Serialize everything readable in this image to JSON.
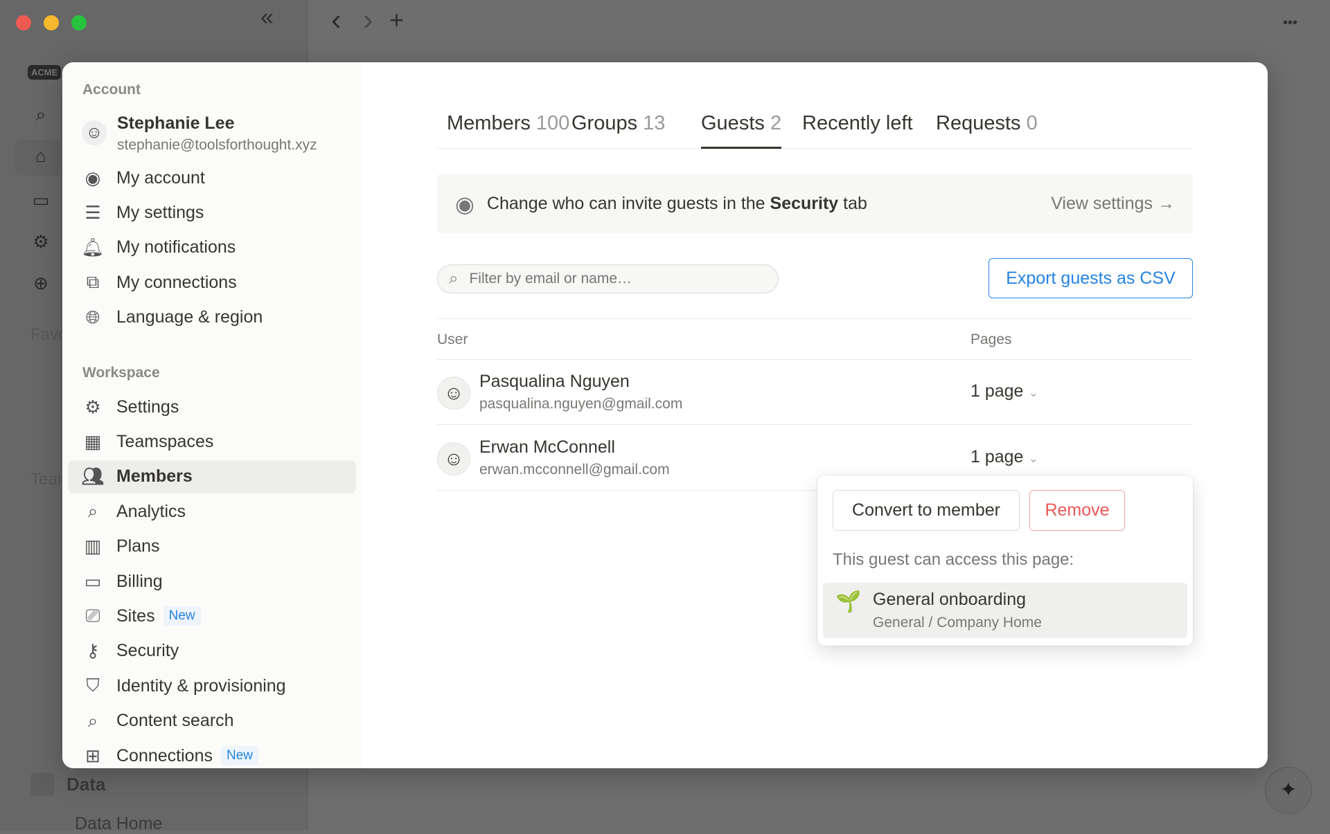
{
  "window": {
    "controls": [
      "close",
      "minimize",
      "zoom"
    ],
    "collapse_icon": "«",
    "back_icon": "‹",
    "forward_icon": "›",
    "add_icon": "+",
    "more_icon": "•••"
  },
  "background_app": {
    "logo": "ACME",
    "section_favorites": "Favo",
    "section_teamspaces": "Tean",
    "data_label": "Data",
    "data_home_label": "Data Home"
  },
  "sidebar": {
    "account_header": "Account",
    "user": {
      "name": "Stephanie Lee",
      "email": "stephanie@toolsforthought.xyz"
    },
    "account_items": [
      {
        "label": "My account",
        "icon": "user-circle-icon"
      },
      {
        "label": "My settings",
        "icon": "sliders-icon"
      },
      {
        "label": "My notifications",
        "icon": "bell-icon"
      },
      {
        "label": "My connections",
        "icon": "arrow-box-icon"
      },
      {
        "label": "Language & region",
        "icon": "globe-icon"
      }
    ],
    "workspace_header": "Workspace",
    "workspace_items": [
      {
        "label": "Settings",
        "icon": "gear-icon"
      },
      {
        "label": "Teamspaces",
        "icon": "building-icon"
      },
      {
        "label": "Members",
        "icon": "people-icon",
        "selected": true
      },
      {
        "label": "Analytics",
        "icon": "magnifier-sparkle-icon"
      },
      {
        "label": "Plans",
        "icon": "map-icon"
      },
      {
        "label": "Billing",
        "icon": "credit-card-icon"
      },
      {
        "label": "Sites",
        "icon": "browser-cursor-icon",
        "badge": "New"
      },
      {
        "label": "Security",
        "icon": "key-icon"
      },
      {
        "label": "Identity & provisioning",
        "icon": "shield-check-icon"
      },
      {
        "label": "Content search",
        "icon": "search-icon"
      },
      {
        "label": "Connections",
        "icon": "grid-icon",
        "badge": "New"
      }
    ]
  },
  "tabs": [
    {
      "label": "Members",
      "count": "100"
    },
    {
      "label": "Groups",
      "count": "13"
    },
    {
      "label": "Guests",
      "count": "2",
      "active": true
    },
    {
      "label": "Recently left",
      "count": ""
    },
    {
      "label": "Requests",
      "count": "0"
    }
  ],
  "banner": {
    "text_pre": "Change who can invite guests in the ",
    "text_bold": "Security",
    "text_post": " tab",
    "link": "View settings →"
  },
  "search": {
    "placeholder": "Filter by email or name…",
    "value": ""
  },
  "export_button": "Export guests as CSV",
  "table": {
    "columns": [
      "User",
      "Pages"
    ],
    "rows": [
      {
        "name": "Pasqualina Nguyen",
        "email": "pasqualina.nguyen@gmail.com",
        "pages": "1 page"
      },
      {
        "name": "Erwan McConnell",
        "email": "erwan.mcconnell@gmail.com",
        "pages": "1 page"
      }
    ]
  },
  "popup": {
    "convert": "Convert to member",
    "remove": "Remove",
    "access_text": "This guest can access this page:",
    "page": {
      "title": "General onboarding",
      "path": "General / Company Home",
      "icon": "seedling-icon"
    }
  },
  "colors": {
    "accent": "#2383e2",
    "danger": "#eb5757"
  }
}
